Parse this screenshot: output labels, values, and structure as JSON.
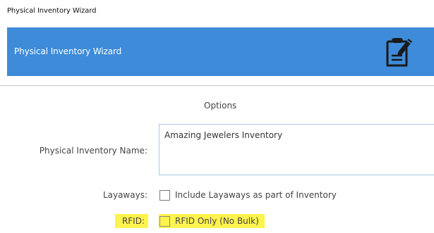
{
  "window": {
    "title": "Physical Inventory Wizard"
  },
  "banner": {
    "title": "Physical Inventory Wizard",
    "icon": "clipboard-pencil-icon",
    "color": "#3d8bd9"
  },
  "section": {
    "title": "Options"
  },
  "form": {
    "name": {
      "label": "Physical Inventory Name:",
      "value": "Amazing Jewelers Inventory"
    },
    "layaways": {
      "label": "Layaways:",
      "checkbox_label": "Include Layaways as part of Inventory",
      "checked": false
    },
    "rfid": {
      "label": "RFID:",
      "checkbox_label": "RFID Only (No Bulk)",
      "checked": false,
      "highlight_color": "#fff34d"
    }
  }
}
